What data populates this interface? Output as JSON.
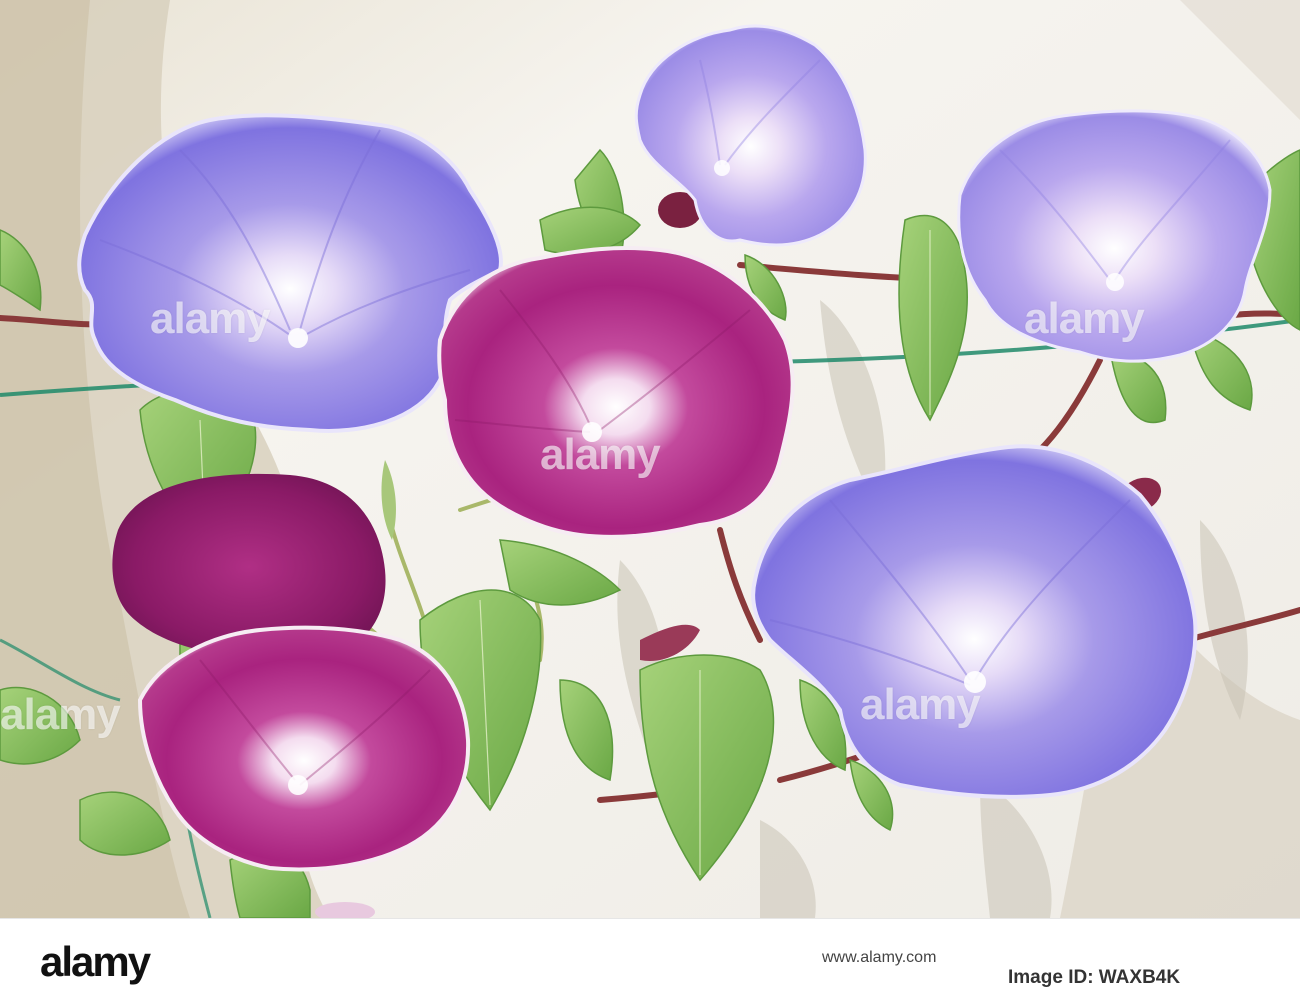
{
  "photo": {
    "subject": "morning-glory-flowers",
    "colors": {
      "wall": "#f2efe9",
      "wall_shadow": "#cfc7b6",
      "blue_petal": "#8c80e8",
      "blue_petal_light": "#b8aef2",
      "magenta_petal": "#b42a8a",
      "magenta_deep": "#8e1a6a",
      "leaf": "#8fc464",
      "leaf_dark": "#5d9a3e",
      "stem": "#8a3a3a",
      "wire": "#1f8a6a"
    }
  },
  "watermark": {
    "text": "alamy"
  },
  "footer": {
    "logo_text": "alamy",
    "image_id": "Image ID: WAXB4K",
    "website": "www.alamy.com"
  }
}
